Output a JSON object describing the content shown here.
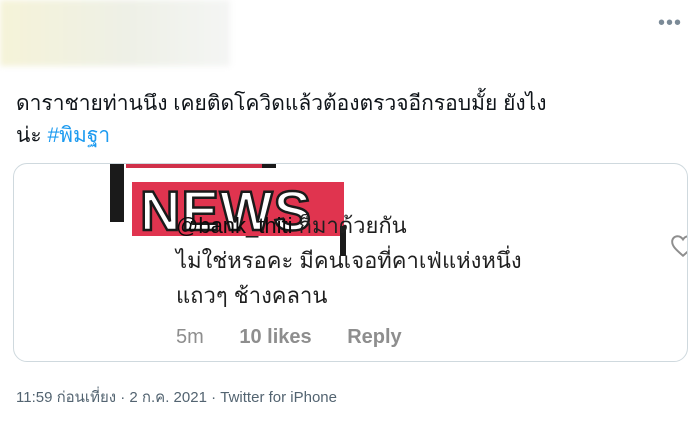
{
  "tweet": {
    "text_line1": "ดาราชายท่านนึง เคยติดโควิดแล้วต้องตรวจอีกรอบมั้ย ยังไง",
    "text_line2_prefix": "น่ะ ",
    "hashtag": "#พิมฐา"
  },
  "card": {
    "logo_text": "NEWS",
    "comment_user": "@bank_thiti",
    "comment_line1_rest": " ก็มาด้วยกัน",
    "comment_line2": "ไม่ใช่หรอคะ มีคนเจอที่คาเฟ่แห่งหนึ่ง",
    "comment_line3": "แถวๆ ช้างคลาน",
    "time_ago": "5m",
    "likes": "10 likes",
    "reply": "Reply"
  },
  "footer": {
    "time": "11:59 ก่อนเที่ยง",
    "date": "2 ก.ค. 2021",
    "source": "Twitter for iPhone",
    "sep": " · "
  },
  "icons": {
    "more": "more-horizontal-icon",
    "heart": "heart-outline-icon"
  },
  "colors": {
    "hashtag": "#1d9bf0",
    "logo_red": "#e0344f",
    "logo_black": "#1a1a1a"
  }
}
